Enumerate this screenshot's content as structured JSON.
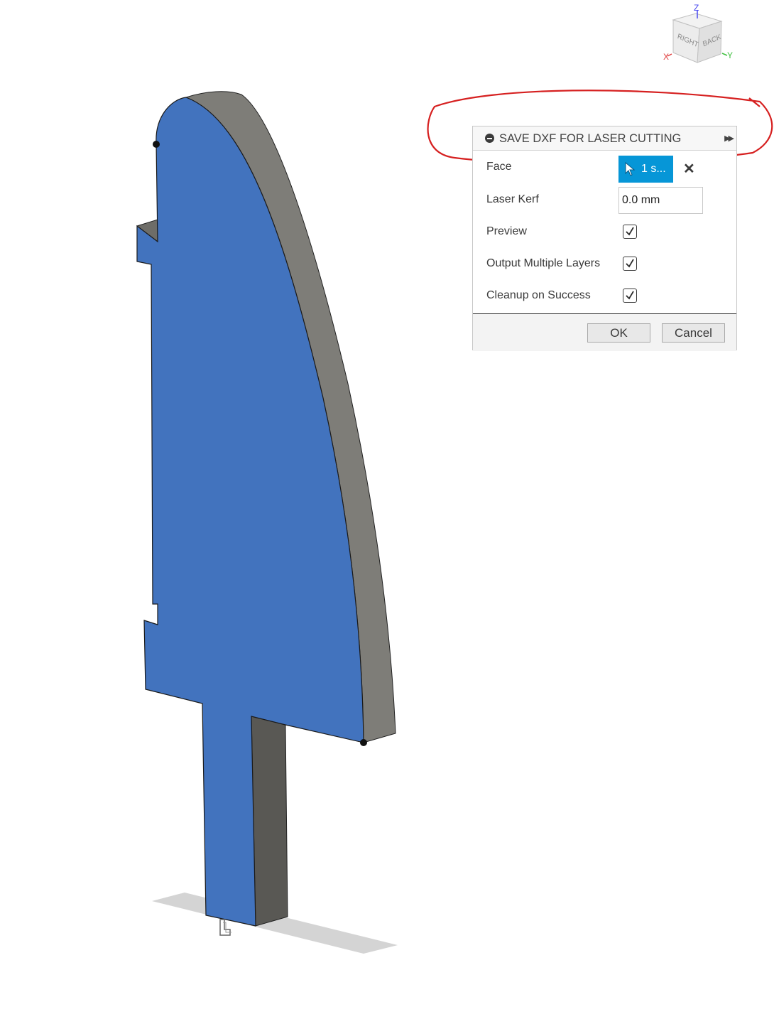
{
  "dialog": {
    "title": "SAVE DXF FOR LASER CUTTING",
    "face": {
      "label": "Face",
      "selection": "1 s..."
    },
    "laser_kerf": {
      "label": "Laser Kerf",
      "value": "0.0 mm"
    },
    "preview": {
      "label": "Preview",
      "checked": true
    },
    "output_multiple_layers": {
      "label": "Output Multiple Layers",
      "checked": true
    },
    "cleanup_on_success": {
      "label": "Cleanup on Success",
      "checked": true
    },
    "ok_label": "OK",
    "cancel_label": "Cancel"
  },
  "view_cube": {
    "top_axis": "Z",
    "left_axis": "X",
    "right_axis": "Y",
    "face_left": "RIGHT",
    "face_right": "BACK"
  },
  "colors": {
    "part_face": "#4273be",
    "part_side": "#7e7d78",
    "accent": "#0696d7",
    "annotation": "#d62020"
  }
}
